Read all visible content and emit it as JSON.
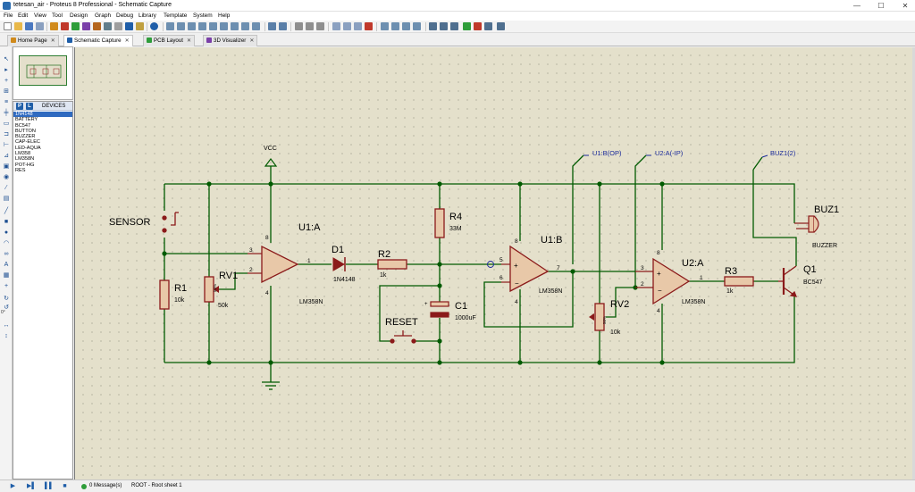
{
  "window": {
    "title": "tetesan_air - Proteus 8 Professional - Schematic Capture",
    "minimize": "—",
    "maximize": "☐",
    "close": "✕"
  },
  "menu": [
    "File",
    "Edit",
    "View",
    "Tool",
    "Design",
    "Graph",
    "Debug",
    "Library",
    "Template",
    "System",
    "Help"
  ],
  "tabs": [
    {
      "label": "Home Page",
      "close": "✕",
      "icon_color": "#d08a1c"
    },
    {
      "label": "Schematic Capture",
      "close": "✕",
      "icon_color": "#1f5ea8"
    },
    {
      "label": "PCB Layout",
      "close": "✕",
      "icon_color": "#2e9d3a"
    },
    {
      "label": "3D Visualizer",
      "close": "✕",
      "icon_color": "#7a3fa8"
    }
  ],
  "device_panel": {
    "p_button": "P",
    "l_button": "L",
    "title": "DEVICES",
    "items": [
      "1N4148",
      "BATTERY",
      "BC547",
      "BUTTON",
      "BUZZER",
      "CAP-ELEC",
      "LED-AQUA",
      "LM358",
      "LM358N",
      "POT-HG",
      "RES"
    ],
    "selected_index": 0
  },
  "tool_rotation": "0°",
  "status": {
    "messages": "0 Message(s)",
    "sheet": "ROOT - Root sheet 1"
  },
  "schematic": {
    "power": "VCC",
    "sensor": "SENSOR",
    "components": {
      "r1": {
        "ref": "R1",
        "value": "10k"
      },
      "rv1": {
        "ref": "RV1",
        "value": "50k",
        "body": "50%"
      },
      "u1a": {
        "ref": "U1:A",
        "part": "LM358N",
        "pin_noninv": "3",
        "pin_inv": "2",
        "pin_out": "1",
        "pin_vcc": "8",
        "pin_gnd": "4"
      },
      "d1": {
        "ref": "D1",
        "part": "1N4148"
      },
      "r2": {
        "ref": "R2",
        "value": "1k"
      },
      "r4": {
        "ref": "R4",
        "value": "33M"
      },
      "c1": {
        "ref": "C1",
        "value": "1000uF"
      },
      "reset": {
        "ref": "RESET"
      },
      "u1b": {
        "ref": "U1:B",
        "part": "LM358N",
        "pin_noninv": "5",
        "pin_inv": "6",
        "pin_out": "7",
        "pin_vcc": "8",
        "pin_gnd": "4"
      },
      "rv2": {
        "ref": "RV2",
        "value": "10k",
        "body": "50%"
      },
      "u2a": {
        "ref": "U2:A",
        "part": "LM358N",
        "pin_noninv": "3",
        "pin_inv": "2",
        "pin_out": "1",
        "pin_vcc": "8",
        "pin_gnd": "4"
      },
      "r3": {
        "ref": "R3",
        "value": "1k"
      },
      "q1": {
        "ref": "Q1",
        "part": "BC547"
      },
      "buz1": {
        "ref": "BUZ1",
        "part": "BUZZER"
      }
    },
    "probes": [
      "U1:B(OP)",
      "U2:A(-IP)",
      "BUZ1(2)"
    ],
    "colors": {
      "wire": "#005a00",
      "component": "#8b1a1a",
      "body_fill": "#e8c8a8",
      "probe": "#1a2a9a",
      "canvas": "#e4e0cb"
    }
  }
}
